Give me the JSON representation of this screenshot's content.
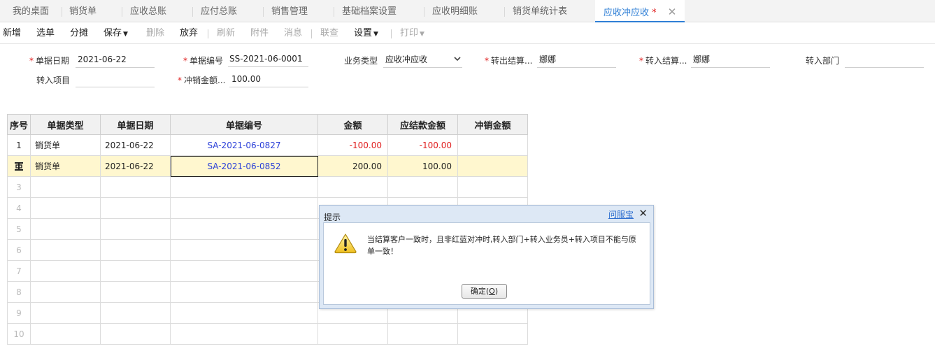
{
  "tabs": [
    {
      "label": "我的桌面"
    },
    {
      "label": "销货单"
    },
    {
      "label": "应收总账"
    },
    {
      "label": "应付总账"
    },
    {
      "label": "销售管理"
    },
    {
      "label": "基础档案设置"
    },
    {
      "label": "应收明细账"
    },
    {
      "label": "销货单统计表"
    },
    {
      "label": "应收冲应收",
      "dirty": "*",
      "close": "✕"
    }
  ],
  "toolbar": {
    "new": "新增",
    "select": "选单",
    "split": "分摊",
    "save": "保存",
    "delete": "删除",
    "discard": "放弃",
    "refresh": "刷新",
    "attachment": "附件",
    "message": "消息",
    "linked_query": "联查",
    "settings": "设置",
    "print": "打印"
  },
  "form": {
    "doc_date": {
      "label": "单据日期",
      "value": "2021-06-22"
    },
    "doc_no": {
      "label": "单据编号",
      "value": "SS-2021-06-0001"
    },
    "biz_type": {
      "label": "业务类型",
      "value": "应收冲应收"
    },
    "out_customer": {
      "label": "转出结算...",
      "value": "娜娜"
    },
    "in_customer": {
      "label": "转入结算...",
      "value": "娜娜"
    },
    "in_dept": {
      "label": "转入部门",
      "value": ""
    },
    "in_project": {
      "label": "转入项目",
      "value": ""
    },
    "offset_amount": {
      "label": "冲销金额...",
      "value": "100.00"
    }
  },
  "grid": {
    "headers": [
      "序号",
      "单据类型",
      "单据日期",
      "单据编号",
      "金额",
      "应结款金额",
      "冲销金额"
    ],
    "rows": [
      {
        "idx": "1",
        "type": "销货单",
        "date": "2021-06-22",
        "no": "SA-2021-06-0827",
        "amount": "-100.00",
        "due": "-100.00",
        "offset": ""
      },
      {
        "idx": "",
        "type": "销货单",
        "date": "2021-06-22",
        "no": "SA-2021-06-0852",
        "amount": "200.00",
        "due": "100.00",
        "offset": ""
      }
    ],
    "empty_rows": [
      "3",
      "4",
      "5",
      "6",
      "7",
      "8",
      "9",
      "10"
    ]
  },
  "dialog": {
    "title": "提示",
    "help": "问服宝",
    "close": "✕",
    "message": "当结算客户一致时，且非红蓝对冲时,转入部门+转入业务员+转入项目不能与原单一致！",
    "ok_label": "确定(",
    "ok_key": "O",
    "ok_suffix": ")"
  }
}
